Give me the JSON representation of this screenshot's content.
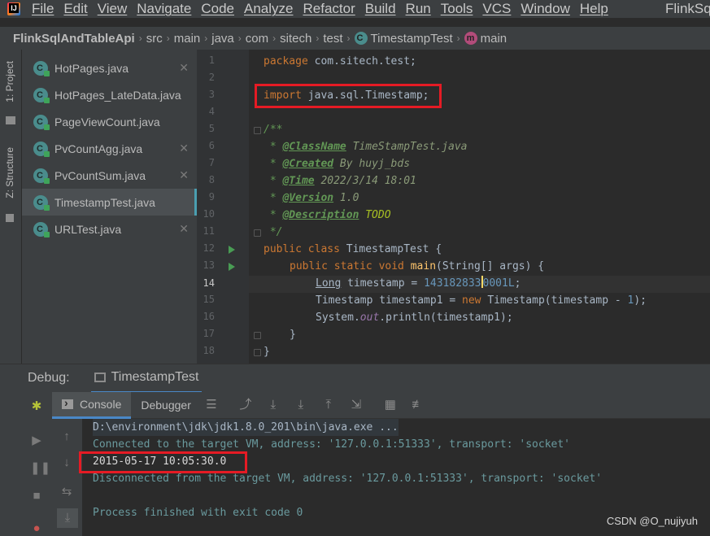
{
  "menubar": {
    "items": [
      "File",
      "Edit",
      "View",
      "Navigate",
      "Code",
      "Analyze",
      "Refactor",
      "Build",
      "Run",
      "Tools",
      "VCS",
      "Window",
      "Help"
    ],
    "title": "FlinkSq"
  },
  "breadcrumb": {
    "project": "FlinkSqlAndTableApi",
    "parts": [
      "src",
      "main",
      "java",
      "com",
      "sitech",
      "test"
    ],
    "file": "TimestampTest",
    "method": "main"
  },
  "sidebar": {
    "project_tab": "1: Project",
    "structure_tab": "Z: Structure"
  },
  "files": [
    {
      "name": "HotPages.java",
      "selected": false
    },
    {
      "name": "HotPages_LateData.java",
      "selected": false
    },
    {
      "name": "PageViewCount.java",
      "selected": false
    },
    {
      "name": "PvCountAgg.java",
      "selected": false
    },
    {
      "name": "PvCountSum.java",
      "selected": false
    },
    {
      "name": "TimestampTest.java",
      "selected": true
    },
    {
      "name": "URLTest.java",
      "selected": false
    }
  ],
  "editor": {
    "line_numbers": [
      "1",
      "2",
      "3",
      "4",
      "5",
      "6",
      "7",
      "8",
      "9",
      "10",
      "11",
      "12",
      "13",
      "14",
      "15",
      "16",
      "17",
      "18"
    ],
    "current_line": "14",
    "code": {
      "l1_kw": "package",
      "l1_rest": " com.sitech.test;",
      "l3_kw": "import",
      "l3_rest": " java.sql.Timestamp;",
      "l5": "/**",
      "l6_prefix": " * ",
      "l6_tag": "@ClassName",
      "l6_val": " TimeStampTest.java",
      "l7_tag": "@Created",
      "l7_val": " By huyj_bds",
      "l8_tag": "@Time",
      "l8_val": " 2022/3/14 18:01",
      "l9_tag": "@Version",
      "l9_val": " 1.0",
      "l10_tag": "@Description",
      "l10_val": "TODO",
      "l11": " */",
      "l12_kw": "public class",
      "l12_rest": " TimestampTest {",
      "l13_kw": "public static void",
      "l13_fn": "main",
      "l13_rest": "(String[] args) {",
      "l14_type": "Long",
      "l14_rest": " timestamp = ",
      "l14_num_a": "143182833",
      "l14_num_b": "0001L",
      "l14_end": ";",
      "l15_a": "Timestamp timestamp1 = ",
      "l15_kw": "new",
      "l15_b": " Timestamp(timestamp - ",
      "l15_num": "1",
      "l15_c": ");",
      "l16_a": "System.",
      "l16_static": "out",
      "l16_b": ".println(timestamp1);",
      "l17": "}",
      "l18": "}"
    }
  },
  "debug": {
    "label": "Debug:",
    "session": "TimestampTest",
    "tabs": [
      "Console",
      "Debugger"
    ],
    "console_lines": [
      "D:\\environment\\jdk\\jdk1.8.0_201\\bin\\java.exe ...",
      "Connected to the target VM, address: '127.0.0.1:51333', transport: 'socket'",
      "2015-05-17 10:05:30.0",
      "Disconnected from the target VM, address: '127.0.0.1:51333', transport: 'socket'",
      "",
      "Process finished with exit code 0"
    ]
  },
  "watermark": "CSDN @O_nujiyuh",
  "colors": {
    "highlight": "#e51b24",
    "accent": "#4a88c7"
  }
}
